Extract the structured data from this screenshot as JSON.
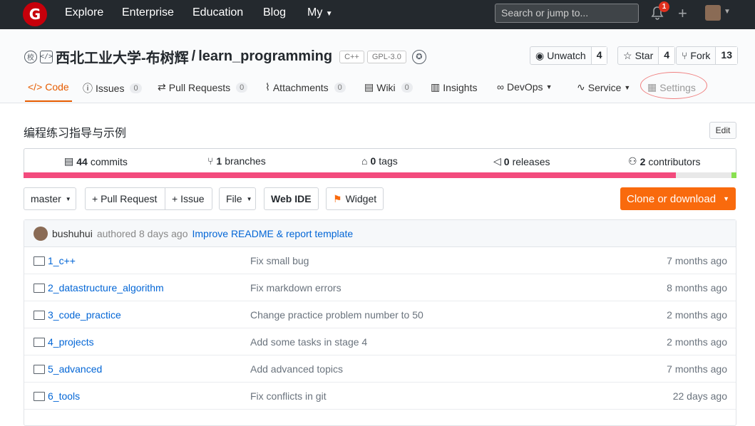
{
  "topbar": {
    "logo_letter": "G",
    "nav": [
      "Explore",
      "Enterprise",
      "Education",
      "Blog",
      "My"
    ],
    "search_placeholder": "Search or jump to...",
    "notification_count": "1"
  },
  "repo": {
    "owner": "西北工业大学-布树辉",
    "separator": "/",
    "name": "learn_programming",
    "tags": [
      "C++",
      "GPL-3.0"
    ],
    "watch": {
      "label": "Unwatch",
      "count": "4"
    },
    "star": {
      "label": "Star",
      "count": "4"
    },
    "fork": {
      "label": "Fork",
      "count": "13"
    }
  },
  "tabs": [
    {
      "label": "Code",
      "count": null
    },
    {
      "label": "Issues",
      "count": "0"
    },
    {
      "label": "Pull Requests",
      "count": "0"
    },
    {
      "label": "Attachments",
      "count": "0"
    },
    {
      "label": "Wiki",
      "count": "0"
    },
    {
      "label": "Insights",
      "count": null
    },
    {
      "label": "DevOps",
      "count": null
    },
    {
      "label": "Service",
      "count": null
    },
    {
      "label": "Settings",
      "count": null
    }
  ],
  "description": "编程练习指导与示例",
  "edit_label": "Edit",
  "summary": {
    "commits": {
      "count": "44",
      "label": "commits"
    },
    "branches": {
      "count": "1",
      "label": "branches"
    },
    "tags": {
      "count": "0",
      "label": "tags"
    },
    "releases": {
      "count": "0",
      "label": "releases"
    },
    "contributors": {
      "count": "2",
      "label": "contributors"
    }
  },
  "language_bar": [
    {
      "color": "#f34b7d",
      "fraction": 0.915
    },
    {
      "color": "#e8e8e8",
      "fraction": 0.078
    },
    {
      "color": "#89e051",
      "fraction": 0.007
    }
  ],
  "toolbar": {
    "branch": "master",
    "pull_request": "+ Pull Request",
    "issue": "+ Issue",
    "file": "File",
    "web_ide": "Web IDE",
    "widget": "Widget",
    "clone": "Clone or download"
  },
  "latest_commit": {
    "author": "bushuhui",
    "when": "authored 8 days ago",
    "message": "Improve README & report template"
  },
  "files": [
    {
      "name": "1_c++",
      "message": "Fix small bug",
      "age": "7 months ago"
    },
    {
      "name": "2_datastructure_algorithm",
      "message": "Fix markdown errors",
      "age": "8 months ago"
    },
    {
      "name": "3_code_practice",
      "message": "Change practice problem number to 50",
      "age": "2 months ago"
    },
    {
      "name": "4_projects",
      "message": "Add some tasks in stage 4",
      "age": "2 months ago"
    },
    {
      "name": "5_advanced",
      "message": "Add advanced topics",
      "age": "7 months ago"
    },
    {
      "name": "6_tools",
      "message": "Fix conflicts in git",
      "age": "22 days ago"
    }
  ]
}
